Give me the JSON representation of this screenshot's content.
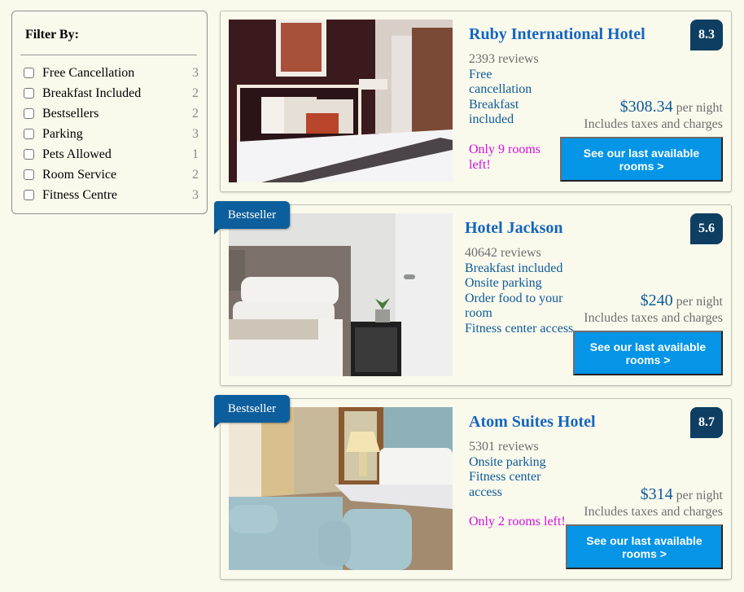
{
  "filters": {
    "title": "Filter By:",
    "items": [
      {
        "label": "Free Cancellation",
        "count": "3",
        "checked": false
      },
      {
        "label": "Breakfast Included",
        "count": "2",
        "checked": false
      },
      {
        "label": "Bestsellers",
        "count": "2",
        "checked": false
      },
      {
        "label": "Parking",
        "count": "3",
        "checked": false
      },
      {
        "label": "Pets Allowed",
        "count": "1",
        "checked": false
      },
      {
        "label": "Room Service",
        "count": "2",
        "checked": false
      },
      {
        "label": "Fitness Centre",
        "count": "3",
        "checked": false
      }
    ]
  },
  "hotels": [
    {
      "name": "Ruby International Hotel",
      "score": "8.3",
      "reviews": "2393 reviews",
      "features": [
        "Free cancellation",
        "Breakfast included"
      ],
      "scarcity": "Only 9 rooms left!",
      "price": "$308.34",
      "per_night": "per night",
      "taxes": "Includes taxes and charges",
      "cta": "See our last available rooms >",
      "bestseller": false,
      "image": "hotel-room-photo-dark-headboard"
    },
    {
      "name": "Hotel Jackson",
      "score": "5.6",
      "reviews": "40642 reviews",
      "features": [
        "Breakfast included",
        "Onsite parking",
        "Order food to your room",
        "Fitness center access"
      ],
      "scarcity": "",
      "price": "$240",
      "per_night": "per night",
      "taxes": "Includes taxes and charges",
      "cta": "See our last available rooms >",
      "bestseller": true,
      "bestseller_label": "Bestseller",
      "image": "hotel-room-photo-grey-bed"
    },
    {
      "name": "Atom Suites Hotel",
      "score": "8.7",
      "reviews": "5301 reviews",
      "features": [
        "Onsite parking",
        "Fitness center access"
      ],
      "scarcity": "Only 2 rooms left!",
      "price": "$314",
      "per_night": "per night",
      "taxes": "Includes taxes and charges",
      "cta": "See our last available rooms >",
      "bestseller": true,
      "bestseller_label": "Bestseller",
      "image": "hotel-room-photo-blue-bench"
    }
  ],
  "colors": {
    "background": "#f9f9ec",
    "hotel_name": "#1565c0",
    "feature_text": "#0d5a99",
    "scarcity_text": "#d60ee1",
    "score_badge": "#0e3e62",
    "cta_button": "#0595e6",
    "bestseller_tag": "#0d5e9c"
  }
}
